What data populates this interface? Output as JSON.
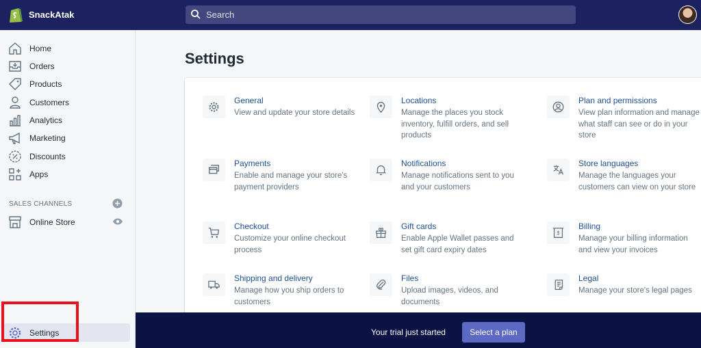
{
  "header": {
    "store_name": "SnackAtak",
    "search_placeholder": "Search"
  },
  "sidebar": {
    "items": [
      {
        "label": "Home",
        "icon": "home-icon"
      },
      {
        "label": "Orders",
        "icon": "orders-icon"
      },
      {
        "label": "Products",
        "icon": "tag-icon"
      },
      {
        "label": "Customers",
        "icon": "person-icon"
      },
      {
        "label": "Analytics",
        "icon": "bar-chart-icon"
      },
      {
        "label": "Marketing",
        "icon": "megaphone-icon"
      },
      {
        "label": "Discounts",
        "icon": "discount-icon"
      },
      {
        "label": "Apps",
        "icon": "apps-icon"
      }
    ],
    "sales_channels_label": "SALES CHANNELS",
    "channels": [
      {
        "label": "Online Store",
        "icon": "store-icon"
      }
    ],
    "settings_label": "Settings"
  },
  "main": {
    "title": "Settings",
    "tiles": [
      {
        "title": "General",
        "desc": "View and update your store details",
        "icon": "gear-icon"
      },
      {
        "title": "Locations",
        "desc": "Manage the places you stock inventory, fulfill orders, and sell products",
        "icon": "location-pin-icon"
      },
      {
        "title": "Plan and permissions",
        "desc": "View plan information and manage what staff can see or do in your store",
        "icon": "person-circle-icon"
      },
      {
        "title": "Payments",
        "desc": "Enable and manage your store's payment providers",
        "icon": "payments-icon"
      },
      {
        "title": "Notifications",
        "desc": "Manage notifications sent to you and your customers",
        "icon": "bell-icon"
      },
      {
        "title": "Store languages",
        "desc": "Manage the languages your customers can view on your store",
        "icon": "translate-icon"
      },
      {
        "title": "Checkout",
        "desc": "Customize your online checkout process",
        "icon": "cart-icon"
      },
      {
        "title": "Gift cards",
        "desc": "Enable Apple Wallet passes and set gift card expiry dates",
        "icon": "gift-icon"
      },
      {
        "title": "Billing",
        "desc": "Manage your billing information and view your invoices",
        "icon": "billing-icon"
      },
      {
        "title": "Shipping and delivery",
        "desc": "Manage how you ship orders to customers",
        "icon": "truck-icon"
      },
      {
        "title": "Files",
        "desc": "Upload images, videos, and documents",
        "icon": "paperclip-icon"
      },
      {
        "title": "Legal",
        "desc": "Manage your store's legal pages",
        "icon": "legal-icon"
      }
    ]
  },
  "trial": {
    "text": "Your trial just started",
    "button": "Select a plan"
  },
  "colors": {
    "topbar": "#1c2260",
    "accent": "#5c6ac4",
    "link": "#1c4f96",
    "highlight": "#e8121c"
  }
}
